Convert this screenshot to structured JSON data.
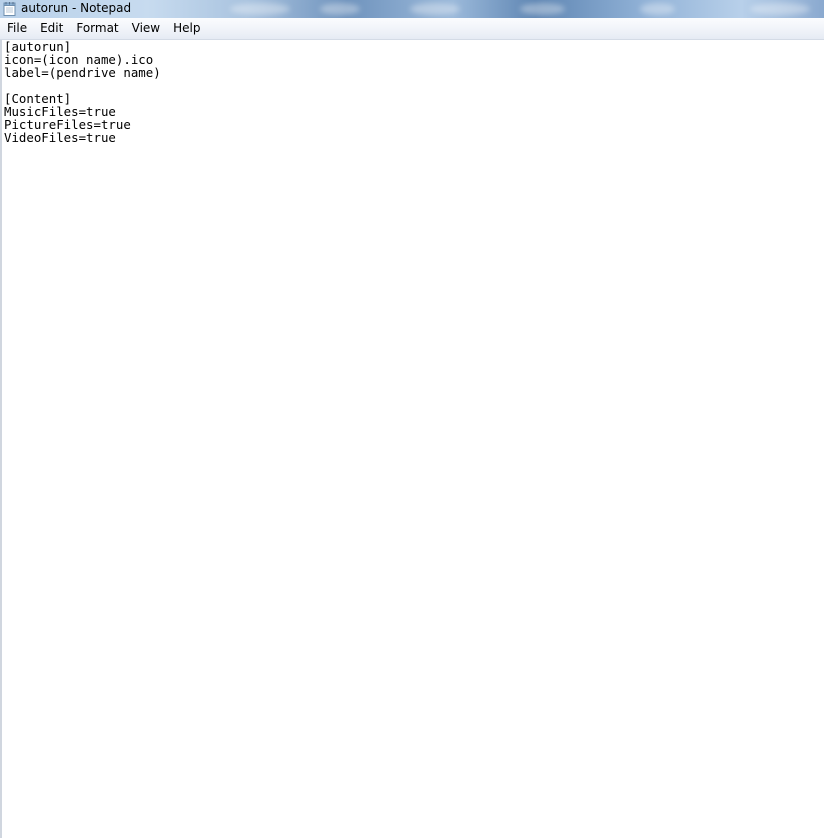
{
  "window": {
    "title": "autorun - Notepad",
    "icon": "notepad-icon"
  },
  "menu": {
    "items": [
      "File",
      "Edit",
      "Format",
      "View",
      "Help"
    ]
  },
  "editor": {
    "lines": [
      "[autorun]",
      "icon=(icon name).ico",
      "label=(pendrive name)",
      "",
      "[Content]",
      "MusicFiles=true",
      "PictureFiles=true",
      "VideoFiles=true"
    ]
  }
}
